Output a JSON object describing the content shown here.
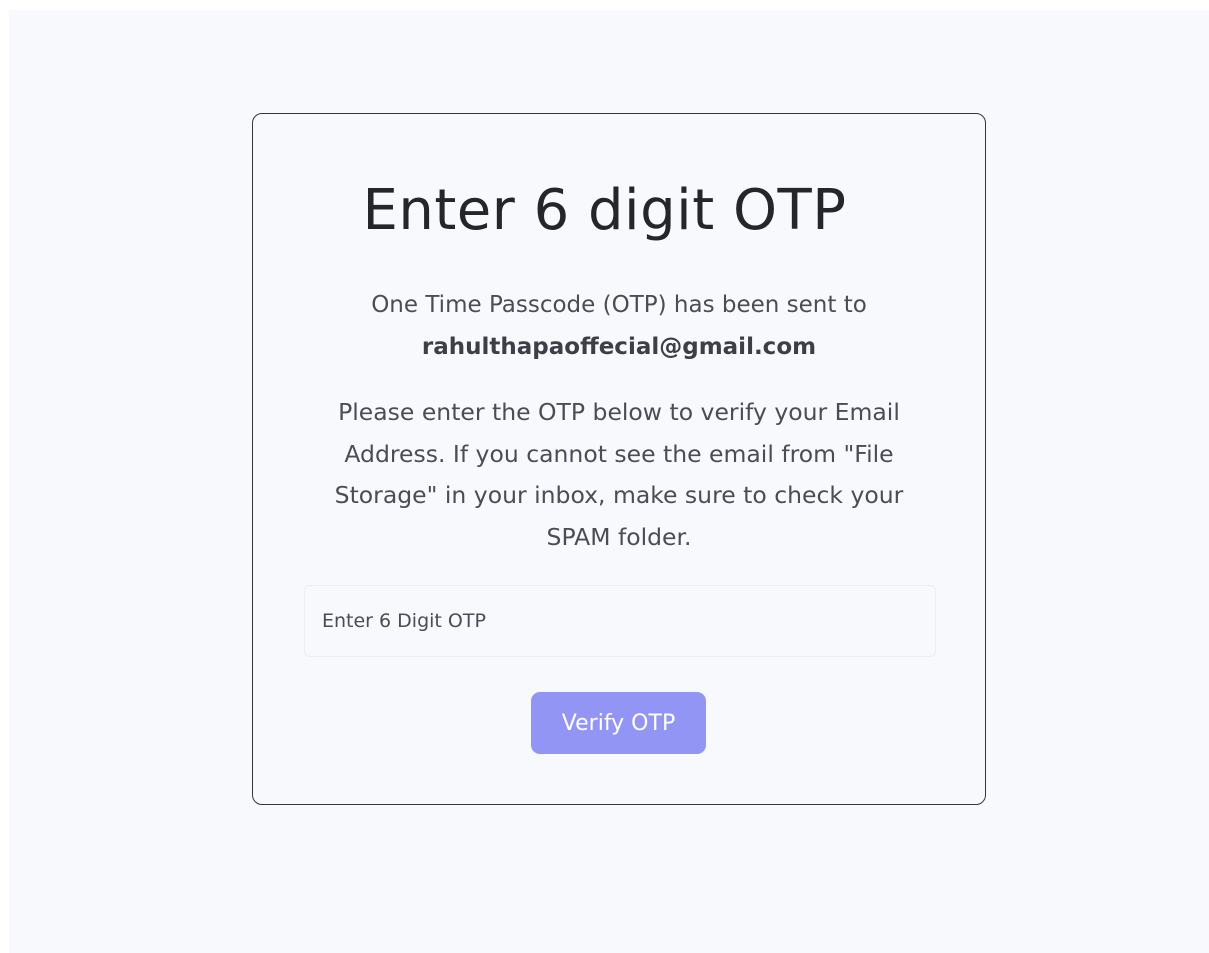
{
  "card": {
    "title": "Enter 6 digit OTP",
    "sent_text": "One Time Passcode (OTP) has been sent to",
    "email": "rahulthapaoffecial@gmail.com",
    "instructions": "Please enter the OTP below to verify your Email Address. If you cannot see the email from \"File Storage\" in your inbox, make sure to check your SPAM folder.",
    "otp_input": {
      "placeholder": "Enter 6 Digit OTP",
      "value": ""
    },
    "verify_button_label": "Verify OTP"
  },
  "colors": {
    "background": "#f8f9fc",
    "card_border": "#33363d",
    "title_text": "#24262b",
    "body_text": "#4a4d55",
    "button_bg": "#9395f4",
    "button_text": "#ffffff"
  }
}
